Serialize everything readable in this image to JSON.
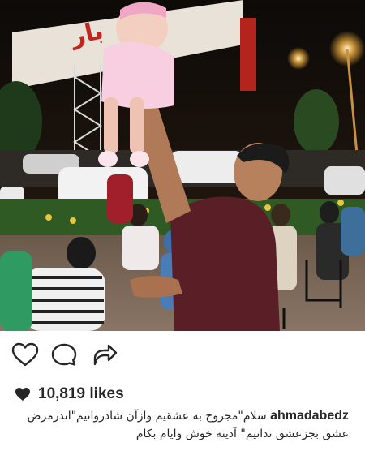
{
  "post": {
    "photo_alt": "",
    "actions": {
      "like_icon": "heart-outline-icon",
      "comment_icon": "comment-bubble-icon",
      "share_icon": "share-arrow-icon"
    },
    "likes": {
      "icon": "heart-filled-icon",
      "text": "10,819 likes"
    },
    "caption": {
      "username": "ahmadabedz",
      "line1_text": "سلام\"مجروح به عشقیم وازآن شادروانیم\"اندرمرض",
      "line2_text": "عشق بجزعشق ندانیم\" آدینه خوش وایام بکام"
    },
    "colors": {
      "text": "#262626",
      "background": "#ffffff"
    }
  }
}
